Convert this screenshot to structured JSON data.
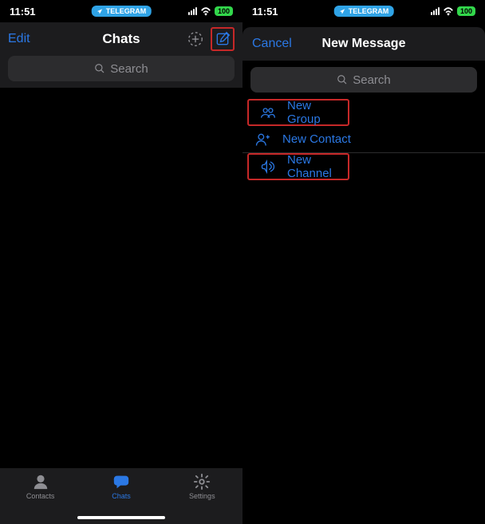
{
  "status": {
    "time": "11:51",
    "app_badge": "TELEGRAM",
    "battery": "100"
  },
  "left": {
    "edit": "Edit",
    "title": "Chats",
    "search_placeholder": "Search",
    "tabs": {
      "contacts": "Contacts",
      "chats": "Chats",
      "settings": "Settings"
    }
  },
  "right": {
    "cancel": "Cancel",
    "title": "New Message",
    "search_placeholder": "Search",
    "menu": {
      "new_group": "New Group",
      "new_contact": "New Contact",
      "new_channel": "New Channel"
    }
  }
}
